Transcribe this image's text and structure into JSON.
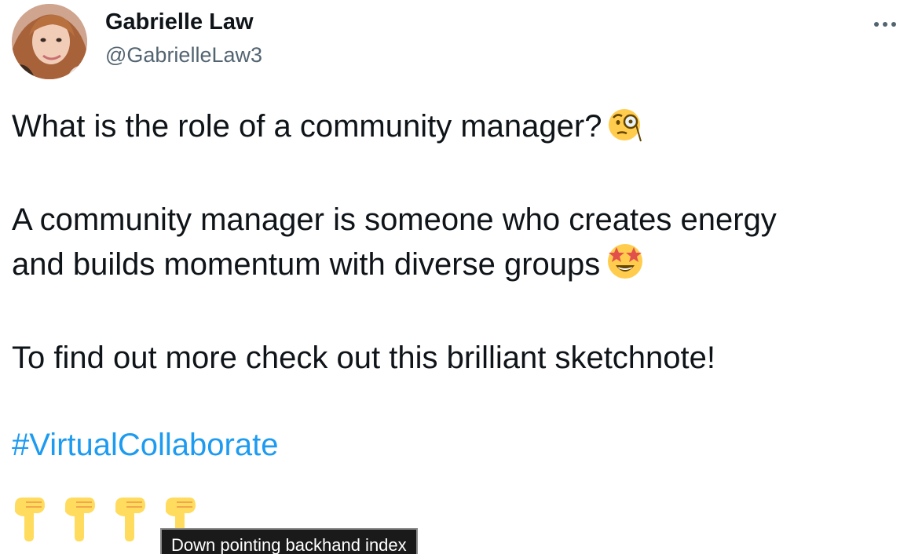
{
  "author": {
    "display_name": "Gabrielle Law",
    "handle": "@GabrielleLaw3",
    "avatar_icon": "profile-photo"
  },
  "menu": {
    "icon": "more-horizontal-icon"
  },
  "tweet": {
    "line1": "What is the role of a community manager?",
    "line1_emoji": "face-with-monocle-icon",
    "line2a": "A community manager is someone who creates energy",
    "line2b": "and builds momentum with diverse groups",
    "line2_emoji": "star-struck-icon",
    "line3": "To find out more check out this brilliant sketchnote!",
    "hashtag": "#VirtualCollaborate",
    "pointing_emojis": [
      "backhand-index-pointing-down-icon",
      "backhand-index-pointing-down-icon",
      "backhand-index-pointing-down-icon",
      "backhand-index-pointing-down-icon"
    ]
  },
  "tooltip": {
    "text": "Down pointing backhand index"
  },
  "colors": {
    "text": "#0f1419",
    "secondary": "#536471",
    "link": "#1d9bf0",
    "tooltip_bg": "#1a1a1a"
  }
}
